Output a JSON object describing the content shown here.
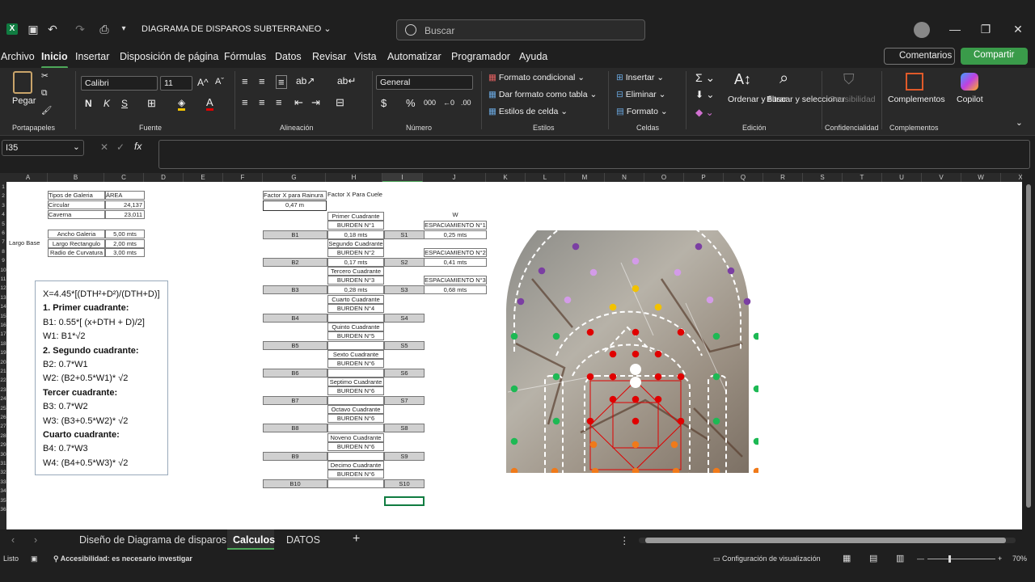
{
  "titlebar": {
    "doc_title": "DIAGRAMA DE DISPAROS SUBTERRANEO",
    "search_placeholder": "Buscar"
  },
  "menu": {
    "items": [
      "Archivo",
      "Inicio",
      "Insertar",
      "Disposición de página",
      "Fórmulas",
      "Datos",
      "Revisar",
      "Vista",
      "Automatizar",
      "Programador",
      "Ayuda"
    ],
    "active": "Inicio",
    "comments": "Comentarios",
    "share": "Compartir"
  },
  "ribbon": {
    "paste": "Pegar",
    "clipboard": "Portapapeles",
    "font_name": "Calibri",
    "font_size": "11",
    "font_group": "Fuente",
    "bold": "N",
    "italic": "K",
    "underline": "S",
    "align_group": "Alineación",
    "number_format": "General",
    "number_group": "Número",
    "cond_format": "Formato condicional",
    "table_format": "Dar formato como tabla",
    "cell_styles": "Estilos de celda",
    "styles_group": "Estilos",
    "insert": "Insertar",
    "delete": "Eliminar",
    "format": "Formato",
    "cells_group": "Celdas",
    "sort": "Ordenar y filtrar",
    "find": "Buscar y seleccionar",
    "edit_group": "Edición",
    "sensitivity": "Sensibilidad",
    "conf_group": "Confidencialidad",
    "addins": "Complementos",
    "addins_group": "Complementos",
    "copilot": "Copilot"
  },
  "formula_bar": {
    "name_box": "I35",
    "fx": "fx"
  },
  "columns": [
    "A",
    "B",
    "C",
    "D",
    "E",
    "F",
    "G",
    "H",
    "I",
    "J",
    "K",
    "L",
    "M",
    "N",
    "O",
    "P",
    "Q",
    "R",
    "S",
    "T",
    "U",
    "V",
    "W",
    "X"
  ],
  "rows": [
    "1",
    "2",
    "3",
    "4",
    "5",
    "6",
    "7",
    "8",
    "9",
    "10",
    "11",
    "12",
    "13",
    "14",
    "15",
    "16",
    "17",
    "18",
    "19",
    "20",
    "21",
    "22",
    "23",
    "24",
    "25",
    "26",
    "27",
    "28",
    "29",
    "30",
    "31",
    "32",
    "33",
    "34",
    "35",
    "36"
  ],
  "sheet": {
    "tipos_header": "Tipos de Galeria",
    "area_header": "ÁREA",
    "circular": "Circular",
    "circular_val": "24,137",
    "caverna": "Caverna",
    "caverna_val": "23,011",
    "ancho": "Ancho Galeria",
    "ancho_val": "5,00 mts",
    "largo_base": "Largo Base",
    "largo_rect": "Largo Rectangulo",
    "largo_rect_val": "2,00 mts",
    "radio": "Radio de Curvatura",
    "radio_val": "3,00 mts",
    "factor_rainura": "Factor X para Rainura",
    "factor_rainura_val": "0,47 m",
    "factor_cuele": "Factor X Para Cuele",
    "w_label": "W",
    "cuadrantes": [
      {
        "name": "Primer Cuadrante",
        "burden": "BURDEN N°1",
        "b": "B1",
        "bval": "0,18 mts",
        "s": "S1",
        "esp": "ESPACIAMIENTO N°1",
        "espval": "0,25 mts"
      },
      {
        "name": "Segundo Cuadrante",
        "burden": "BURDEN N°2",
        "b": "B2",
        "bval": "0,17 mts",
        "s": "S2",
        "esp": "ESPACIAMIENTO N°2",
        "espval": "0,41 mts"
      },
      {
        "name": "Tercero Cuadrante",
        "burden": "BURDEN N°3",
        "b": "B3",
        "bval": "0,28 mts",
        "s": "S3",
        "esp": "ESPACIAMIENTO N°3",
        "espval": "0,68 mts"
      },
      {
        "name": "Cuarto Cuadrante",
        "burden": "BURDEN N°4",
        "b": "B4",
        "bval": "",
        "s": "S4"
      },
      {
        "name": "Quinto Cuadrante",
        "burden": "BURDEN N°5",
        "b": "B5",
        "bval": "",
        "s": "S5"
      },
      {
        "name": "Sexto Cuadrante",
        "burden": "BURDEN N°6",
        "b": "B6",
        "bval": "",
        "s": "S6"
      },
      {
        "name": "Septimo Cuadrante",
        "burden": "BURDEN N°6",
        "b": "B7",
        "bval": "",
        "s": "S7"
      },
      {
        "name": "Octavo Cuadrante",
        "burden": "BURDEN N°6",
        "b": "B8",
        "bval": "",
        "s": "S8"
      },
      {
        "name": "Noveno Cuadrante",
        "burden": "BURDEN N°6",
        "b": "B9",
        "bval": "",
        "s": "S9"
      },
      {
        "name": "Decimo Cuadrante",
        "burden": "BURDEN N°6",
        "b": "B10",
        "bval": "",
        "s": "S10"
      }
    ],
    "formula_lines": [
      {
        "t": "X=4.45*[(DTH²+D²)/(DTH+D)]",
        "b": false
      },
      {
        "t": "1.     Primer cuadrante:",
        "b": true
      },
      {
        "t": "B1: 0.55*[ (x+DTH + D)/2]",
        "b": false
      },
      {
        "t": "W1: B1*√2",
        "b": false
      },
      {
        "t": "2.     Segundo cuadrante:",
        "b": true
      },
      {
        "t": "B2: 0.7*W1",
        "b": false
      },
      {
        "t": "W2: (B2+0.5*W1)* √2",
        "b": false
      },
      {
        "t": "Tercer cuadrante:",
        "b": true
      },
      {
        "t": "B3: 0.7*W2",
        "b": false
      },
      {
        "t": "W3: (B3+0.5*W2)* √2",
        "b": false
      },
      {
        "t": "Cuarto cuadrante:",
        "b": true
      },
      {
        "t": "B4: 0.7*W3",
        "b": false
      },
      {
        "t": "W4: (B4+0.5*W3)* √2",
        "b": false
      }
    ]
  },
  "tabs": {
    "items": [
      "Diseño de Diagrama de disparos",
      "Calculos",
      "DATOS"
    ],
    "active": "Calculos"
  },
  "status": {
    "ready": "Listo",
    "accessibility": "Accesibilidad: es necesario investigar",
    "display": "Configuración de visualización",
    "zoom": "70%"
  },
  "colors": {
    "accent": "#4ea85a",
    "red": "#e00000",
    "green": "#1db954",
    "orange": "#f07a1a",
    "purple": "#7b3fa3",
    "lilac": "#d39be8",
    "yellow": "#f2c200"
  }
}
